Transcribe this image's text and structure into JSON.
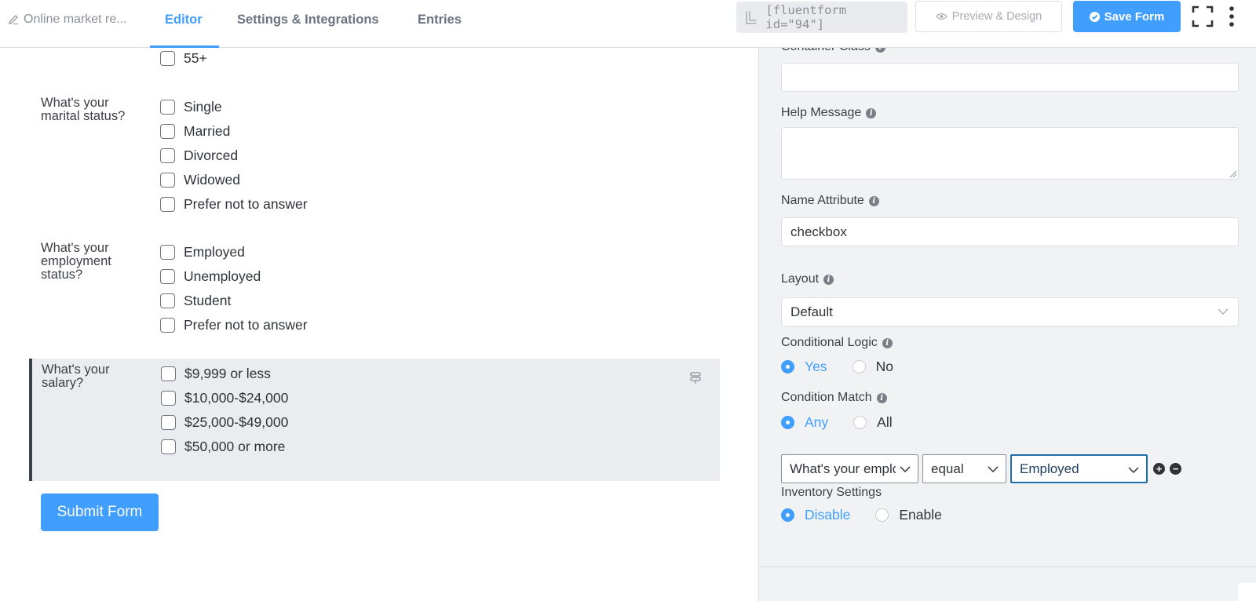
{
  "header": {
    "breadcrumb": "Online market re...",
    "tabs": [
      {
        "label": "Editor",
        "active": true
      },
      {
        "label": "Settings & Integrations",
        "active": false
      },
      {
        "label": "Entries",
        "active": false
      }
    ],
    "shortcode": "[fluentform id=\"94\"]",
    "preview_label": "Preview & Design",
    "save_label": "Save Form",
    "accent_color": "#409eff"
  },
  "editor": {
    "age_tail_option": "55+",
    "marital": {
      "question": "What's your marital status?",
      "options": [
        "Single",
        "Married",
        "Divorced",
        "Widowed",
        "Prefer not to answer"
      ]
    },
    "employment": {
      "question": "What's your employment status?",
      "options": [
        "Employed",
        "Unemployed",
        "Student",
        "Prefer not to answer"
      ]
    },
    "salary": {
      "question": "What's your salary?",
      "options": [
        "$9,999 or less",
        "$10,000-$24,000",
        "$25,000-$49,000",
        "$50,000 or more"
      ]
    },
    "submit_label": "Submit Form"
  },
  "panel": {
    "container_class": {
      "label": "Container Class",
      "value": ""
    },
    "help_message": {
      "label": "Help Message",
      "value": ""
    },
    "name_attribute": {
      "label": "Name Attribute",
      "value": "checkbox"
    },
    "layout": {
      "label": "Layout",
      "value": "Default"
    },
    "conditional_logic": {
      "label": "Conditional Logic",
      "options": [
        "Yes",
        "No"
      ],
      "selected": "Yes"
    },
    "condition_match": {
      "label": "Condition Match",
      "options": [
        "Any",
        "All"
      ],
      "selected": "Any"
    },
    "condition": {
      "field": "What's your employment status?",
      "operator": "equal",
      "value": "Employed"
    },
    "inventory": {
      "label": "Inventory Settings",
      "options": [
        "Disable",
        "Enable"
      ],
      "selected": "Disable"
    }
  }
}
